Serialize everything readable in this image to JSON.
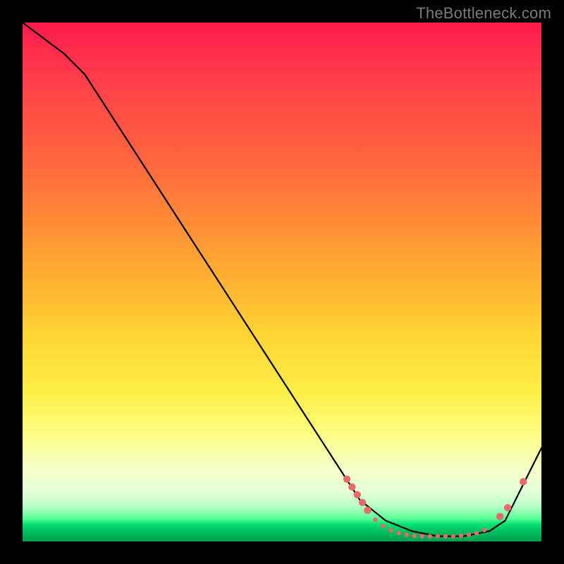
{
  "watermark": "TheBottleneck.com",
  "chart_data": {
    "type": "line",
    "title": "",
    "xlabel": "",
    "ylabel": "",
    "xlim": [
      0,
      100
    ],
    "ylim": [
      0,
      100
    ],
    "grid": false,
    "legend": false,
    "series": [
      {
        "name": "curve",
        "color": "#000000",
        "x": [
          0,
          8,
          12,
          65,
          70,
          75,
          80,
          85,
          90,
          93,
          100
        ],
        "values": [
          100,
          94,
          90,
          8,
          4,
          2,
          1,
          1,
          2,
          4,
          18
        ]
      }
    ],
    "markers": {
      "name": "highlight-dots",
      "color": "#e86a6a",
      "radius_small": 3.2,
      "radius_large": 5.2,
      "points": [
        {
          "x": 62.5,
          "y": 12.0,
          "r": "large"
        },
        {
          "x": 63.5,
          "y": 10.5,
          "r": "large"
        },
        {
          "x": 64.5,
          "y": 9.0,
          "r": "large"
        },
        {
          "x": 65.5,
          "y": 7.5,
          "r": "large"
        },
        {
          "x": 66.5,
          "y": 6.0,
          "r": "large"
        },
        {
          "x": 68.0,
          "y": 4.2,
          "r": "small"
        },
        {
          "x": 69.5,
          "y": 3.0,
          "r": "small"
        },
        {
          "x": 71.0,
          "y": 2.2,
          "r": "small"
        },
        {
          "x": 72.5,
          "y": 1.6,
          "r": "small"
        },
        {
          "x": 74.0,
          "y": 1.3,
          "r": "small"
        },
        {
          "x": 75.5,
          "y": 1.1,
          "r": "small"
        },
        {
          "x": 77.0,
          "y": 1.0,
          "r": "small"
        },
        {
          "x": 78.5,
          "y": 1.0,
          "r": "small"
        },
        {
          "x": 80.0,
          "y": 1.0,
          "r": "small"
        },
        {
          "x": 81.5,
          "y": 1.0,
          "r": "small"
        },
        {
          "x": 83.0,
          "y": 1.0,
          "r": "small"
        },
        {
          "x": 84.5,
          "y": 1.1,
          "r": "small"
        },
        {
          "x": 86.0,
          "y": 1.3,
          "r": "small"
        },
        {
          "x": 87.5,
          "y": 1.6,
          "r": "small"
        },
        {
          "x": 89.0,
          "y": 2.2,
          "r": "small"
        },
        {
          "x": 92.0,
          "y": 4.8,
          "r": "large"
        },
        {
          "x": 93.5,
          "y": 6.5,
          "r": "large"
        },
        {
          "x": 96.5,
          "y": 11.5,
          "r": "large"
        }
      ]
    }
  }
}
